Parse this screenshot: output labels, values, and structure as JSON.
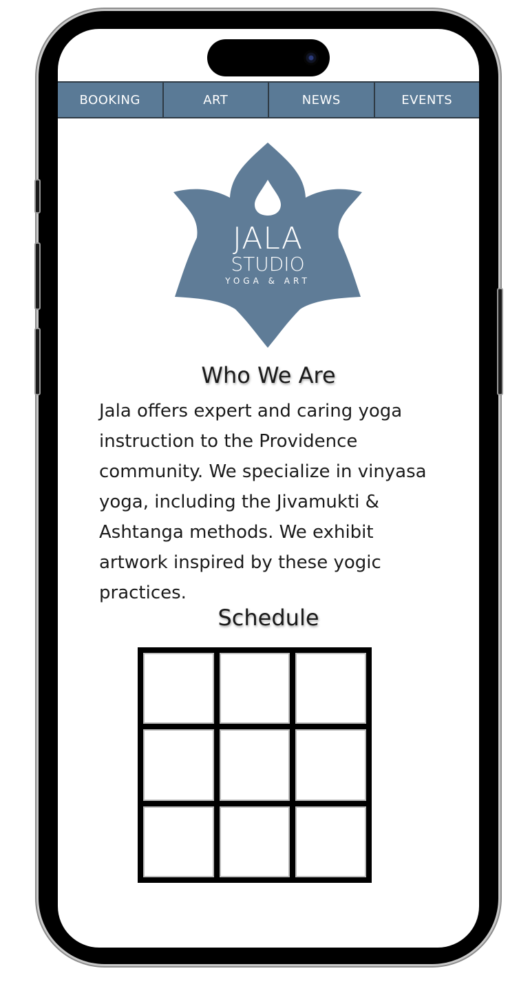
{
  "nav": {
    "items": [
      {
        "label": "BOOKING"
      },
      {
        "label": "ART"
      },
      {
        "label": "NEWS"
      },
      {
        "label": "EVENTS"
      }
    ]
  },
  "logo": {
    "line1": "JALA",
    "line2": "STUDIO",
    "line3": "YOGA & ART",
    "color": "#5f7c97"
  },
  "about": {
    "title": "Who We Are",
    "lines": [
      "Jala offers expert and caring yoga",
      "instruction to the Providence",
      "community. We specialize in vinyasa",
      "yoga, including the Jivamukti &",
      "Ashtanga methods. We exhibit",
      "artwork inspired by these yogic",
      "practices."
    ]
  },
  "schedule": {
    "title": "Schedule",
    "rows": 3,
    "cols": 3
  },
  "colors": {
    "nav_bg": "#5a7a96",
    "brand": "#5f7c97"
  }
}
